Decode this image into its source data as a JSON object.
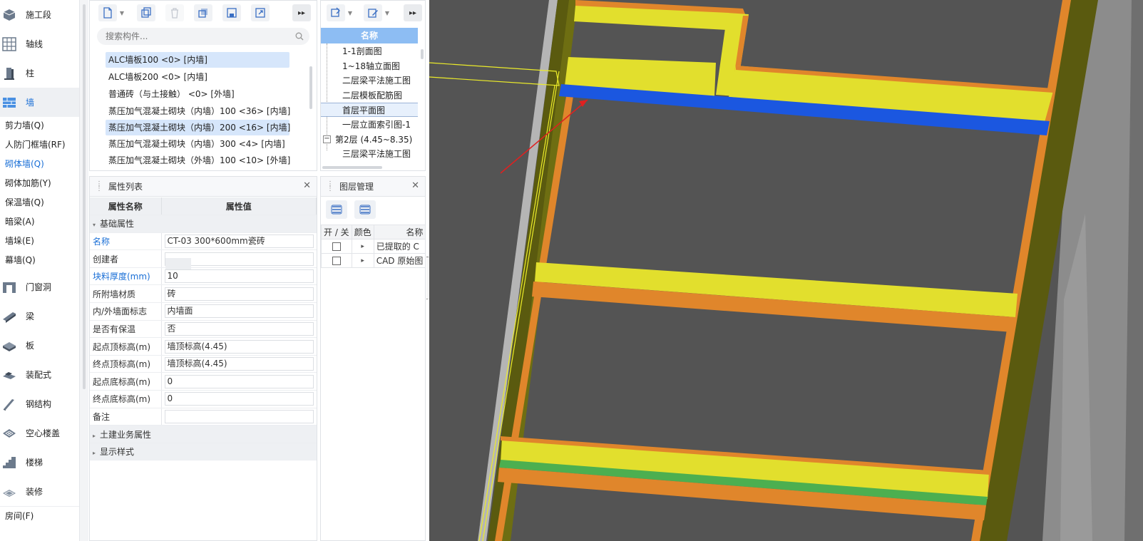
{
  "nav": {
    "categories": [
      {
        "label": "施工段",
        "icon": "construction-section-icon"
      },
      {
        "label": "轴线",
        "icon": "grid-axis-icon"
      },
      {
        "label": "柱",
        "icon": "column-icon"
      },
      {
        "label": "墙",
        "icon": "wall-icon"
      },
      {
        "label": "门窗洞",
        "icon": "door-window-icon"
      },
      {
        "label": "梁",
        "icon": "beam-icon"
      },
      {
        "label": "板",
        "icon": "slab-icon"
      },
      {
        "label": "装配式",
        "icon": "prefab-icon"
      },
      {
        "label": "钢结构",
        "icon": "steel-structure-icon"
      },
      {
        "label": "空心楼盖",
        "icon": "hollow-floor-icon"
      },
      {
        "label": "楼梯",
        "icon": "stairs-icon"
      },
      {
        "label": "装修",
        "icon": "decoration-icon"
      }
    ],
    "wall_subs": [
      "剪力墙(Q)",
      "人防门框墙(RF)",
      "砌体墙(Q)",
      "砌体加筋(Y)",
      "保温墙(Q)",
      "暗梁(A)",
      "墙垛(E)",
      "幕墙(Q)"
    ],
    "bottom_sub": "房间(F)",
    "active_category": "墙",
    "active_sub": "砌体墙(Q)"
  },
  "components": {
    "search_placeholder": "搜索构件...",
    "items": [
      "ALC墙板100 <0> [内墙]",
      "ALC墙板200 <0> [内墙]",
      "普通砖（与土接触） <0> [外墙]",
      "蒸压加气混凝土砌块（内墙）100 <36> [内墙]",
      "蒸压加气混凝土砌块（内墙）200 <16> [内墙]",
      "蒸压加气混凝土砌块（内墙）300 <4> [内墙]",
      "蒸压加气混凝土砌块（外墙）100 <10> [外墙]"
    ]
  },
  "properties": {
    "title": "属性列表",
    "col_name": "属性名称",
    "col_value": "属性值",
    "group_basic": "基础属性",
    "rows": [
      {
        "name": "名称",
        "value": "CT-03 300*600mm瓷砖",
        "blue": true
      },
      {
        "name": "创建者",
        "value": "",
        "blue": false
      },
      {
        "name": "块料厚度(mm)",
        "value": "10",
        "blue": true
      },
      {
        "name": "所附墙材质",
        "value": "砖",
        "blue": false
      },
      {
        "name": "内/外墙面标志",
        "value": "内墙面",
        "blue": false
      },
      {
        "name": "是否有保温",
        "value": "否",
        "blue": false
      },
      {
        "name": "起点顶标高(m)",
        "value": "墙顶标高(4.45)",
        "blue": false
      },
      {
        "name": "终点顶标高(m)",
        "value": "墙顶标高(4.45)",
        "blue": false
      },
      {
        "name": "起点底标高(m)",
        "value": "0",
        "blue": false
      },
      {
        "name": "终点底标高(m)",
        "value": "0",
        "blue": false
      },
      {
        "name": "备注",
        "value": "",
        "blue": false
      }
    ],
    "group_civil": "土建业务属性",
    "group_display": "显示样式"
  },
  "drawings": {
    "header": "名称",
    "items": [
      "1-1剖面图",
      "1~18轴立面图",
      "二层梁平法施工图",
      "二层模板配筋图",
      "首层平面图",
      "一层立面索引图-1"
    ],
    "floor_label": "第2层 (4.45~8.35)",
    "floor_expander": "−",
    "floor_child": "三层梁平法施工图"
  },
  "layers": {
    "title": "图层管理",
    "col_toggle": "开 / 关",
    "col_color": "颜色",
    "col_name": "名称",
    "rows": [
      {
        "name": "已提取的 C"
      },
      {
        "name": "CAD 原始图"
      }
    ]
  },
  "colors": {
    "active_blue": "#1a6fd6",
    "viewport_bg": "#545454",
    "wall_olive": "#5a5a0f",
    "slab_yellow": "#e2df2d",
    "edge_orange": "#e0862b",
    "highlight_blue": "#1b57e0",
    "green_strip": "#4caf50"
  }
}
